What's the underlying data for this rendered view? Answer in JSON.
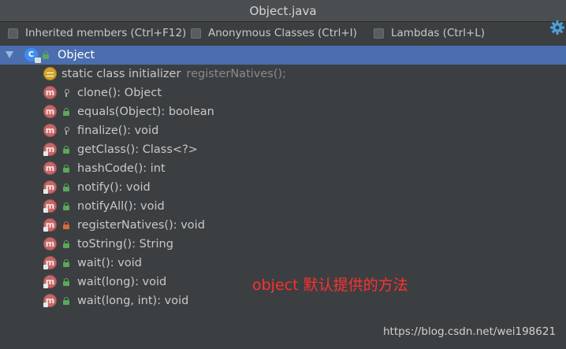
{
  "window": {
    "title": "Object.java"
  },
  "toolbar": {
    "inherited_label": "Inherited members (Ctrl+F12)",
    "anonymous_label": "Anonymous Classes (Ctrl+I)",
    "lambdas_label": "Lambdas (Ctrl+L)",
    "settings_icon": "gear-icon"
  },
  "tree": {
    "root_label": "Object",
    "initializer": {
      "label": "static class initializer",
      "detail": "registerNatives();"
    },
    "methods": [
      {
        "label": "clone(): Object",
        "visibility": "protected"
      },
      {
        "label": "equals(Object): boolean",
        "visibility": "public"
      },
      {
        "label": "finalize(): void",
        "visibility": "protected"
      },
      {
        "label": "getClass(): Class<?>",
        "visibility": "public"
      },
      {
        "label": "hashCode(): int",
        "visibility": "public"
      },
      {
        "label": "notify(): void",
        "visibility": "public"
      },
      {
        "label": "notifyAll(): void",
        "visibility": "public"
      },
      {
        "label": "registerNatives(): void",
        "visibility": "private"
      },
      {
        "label": "toString(): String",
        "visibility": "public"
      },
      {
        "label": "wait(): void",
        "visibility": "public"
      },
      {
        "label": "wait(long): void",
        "visibility": "public"
      },
      {
        "label": "wait(long, int): void",
        "visibility": "public"
      }
    ]
  },
  "annotation": "object 默认提供的方法",
  "watermark": "https://blog.csdn.net/wei198621",
  "colors": {
    "selection": "#4b6eaf",
    "annotation": "#ff3030",
    "method_icon": "#c46868",
    "initializer_icon": "#d2a32e",
    "class_icon": "#3d8ef0"
  }
}
